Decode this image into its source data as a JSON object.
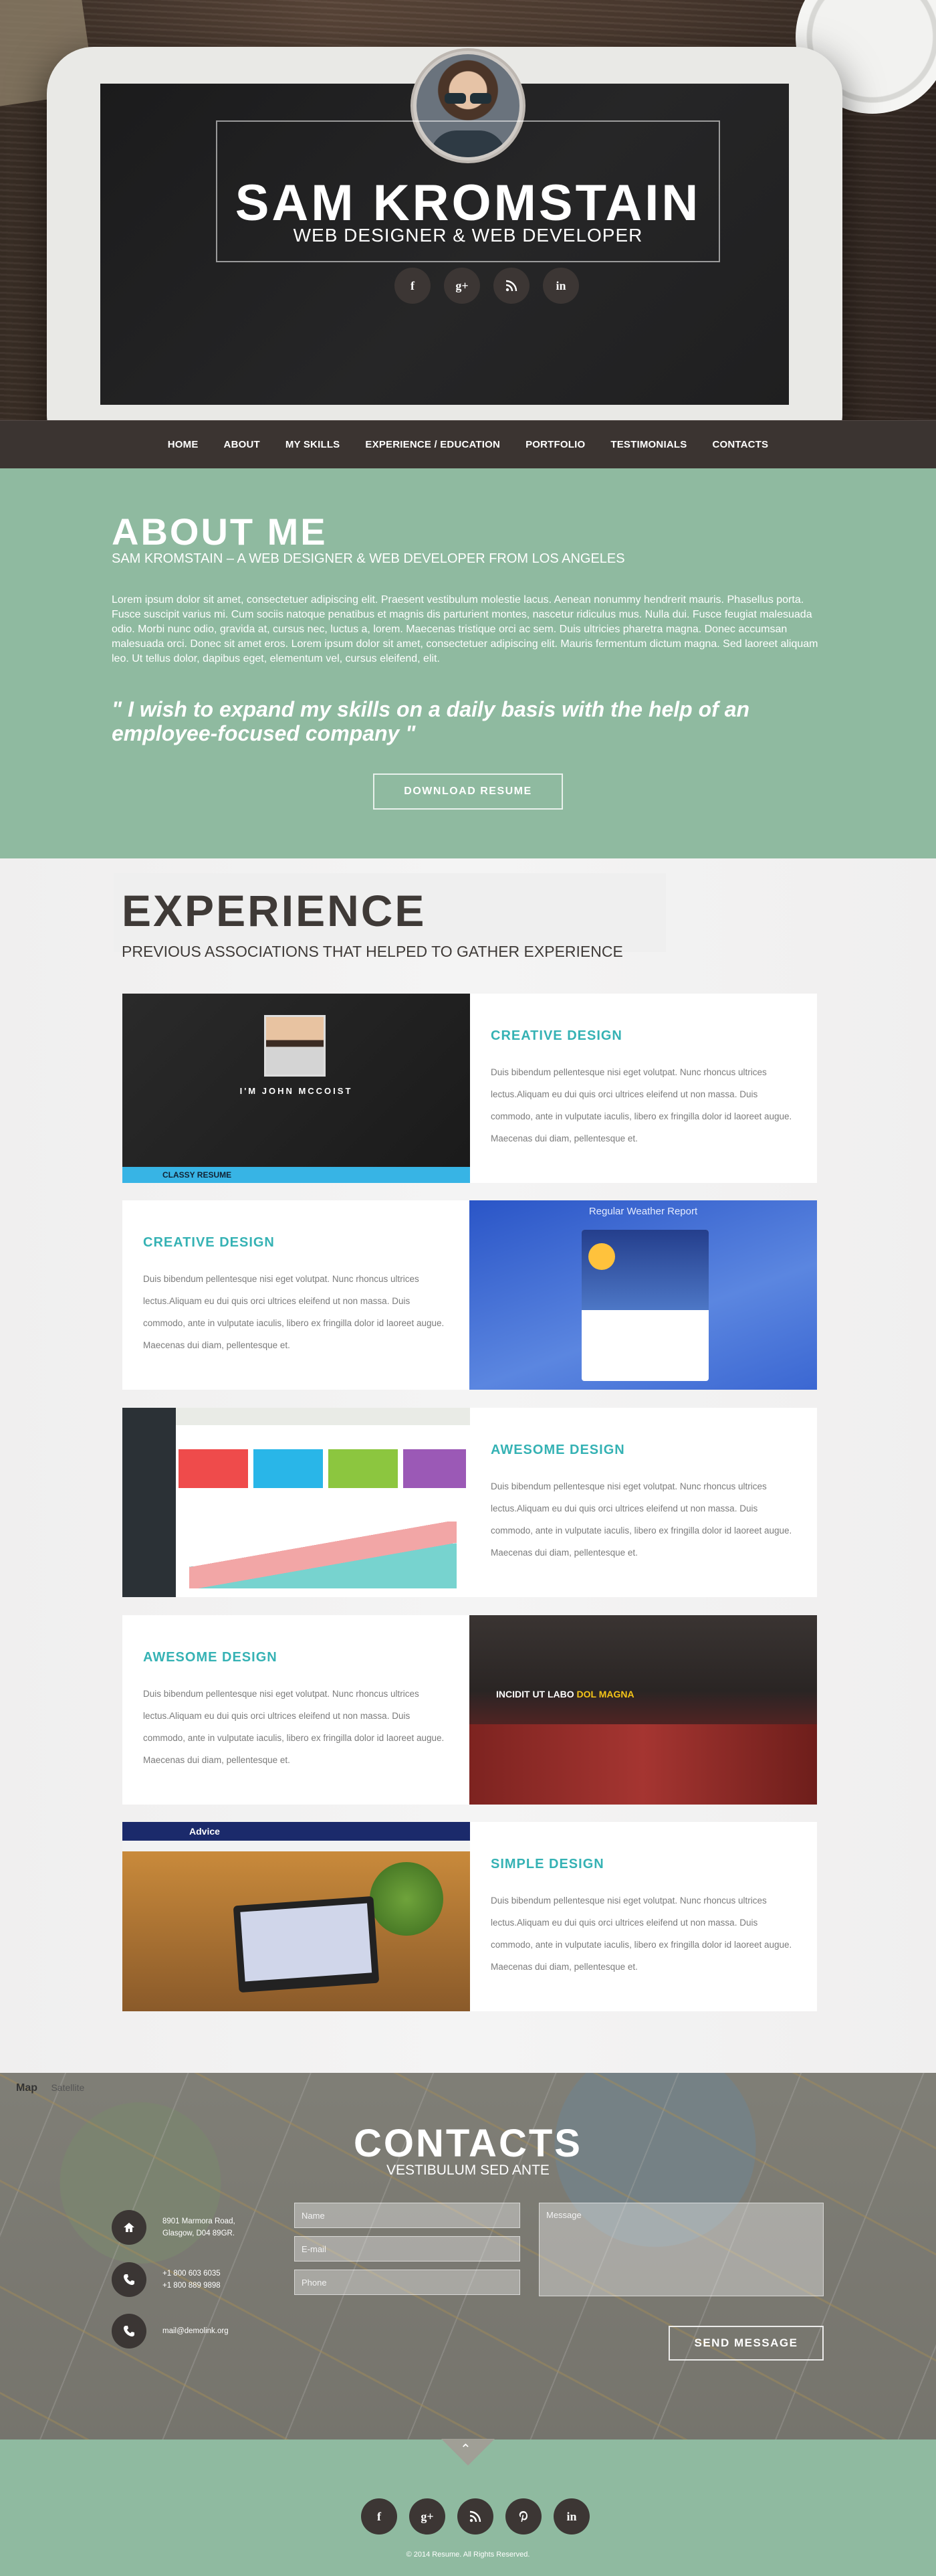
{
  "hero": {
    "name": "SAM KROMSTAIN",
    "title": "WEB DESIGNER & WEB DEVELOPER",
    "social": [
      {
        "icon": "facebook-icon",
        "glyph": "f"
      },
      {
        "icon": "google-plus-icon",
        "glyph": "g+"
      },
      {
        "icon": "rss-icon",
        "glyph": ""
      },
      {
        "icon": "linkedin-icon",
        "glyph": "in"
      }
    ]
  },
  "nav": [
    "HOME",
    "ABOUT",
    "MY SKILLS",
    "EXPERIENCE / EDUCATION",
    "PORTFOLIO",
    "TESTIMONIALS",
    "CONTACTS"
  ],
  "about": {
    "heading": "ABOUT ME",
    "subheading": "SAM KROMSTAIN – A WEB DESIGNER & WEB DEVELOPER FROM LOS ANGELES",
    "body": "Lorem ipsum dolor sit amet, consectetuer adipiscing elit. Praesent vestibulum molestie lacus. Aenean nonummy hendrerit mauris. Phasellus porta. Fusce suscipit varius mi. Cum sociis natoque penatibus et magnis dis parturient montes, nascetur ridiculus mus. Nulla dui. Fusce feugiat malesuada odio. Morbi nunc odio, gravida at, cursus nec, luctus a, lorem. Maecenas tristique orci ac sem. Duis ultricies pharetra magna. Donec accumsan malesuada orci. Donec sit amet eros. Lorem ipsum dolor sit amet, consectetuer adipiscing elit. Mauris fermentum dictum magna. Sed laoreet aliquam leo. Ut tellus dolor, dapibus eget, elementum vel, cursus eleifend, elit.",
    "quote": "\" I wish to expand my skills on a daily basis with the help of an employee-focused company \"",
    "button": "DOWNLOAD RESUME"
  },
  "experience": {
    "heading": "EXPERIENCE",
    "subheading": "PREVIOUS ASSOCIATIONS THAT HELPED TO GATHER EXPERIENCE",
    "items": [
      {
        "title": "CREATIVE DESIGN",
        "text": "Duis bibendum pellentesque nisi eget volutpat. Nunc rhoncus ultrices lectus.Aliquam eu dui quis orci ultrices eleifend ut non massa. Duis commodo, ante in vulputate iaculis, libero ex fringilla dolor id laoreet augue. Maecenas dui diam, pellentesque et."
      },
      {
        "title": "CREATIVE DESIGN",
        "text": "Duis bibendum pellentesque nisi eget volutpat. Nunc rhoncus ultrices lectus.Aliquam eu dui quis orci ultrices eleifend ut non massa. Duis commodo, ante in vulputate iaculis, libero ex fringilla dolor id laoreet augue. Maecenas dui diam, pellentesque et."
      },
      {
        "title": "AWESOME DESIGN",
        "text": "Duis bibendum pellentesque nisi eget volutpat. Nunc rhoncus ultrices lectus.Aliquam eu dui quis orci ultrices eleifend ut non massa. Duis commodo, ante in vulputate iaculis, libero ex fringilla dolor id laoreet augue. Maecenas dui diam, pellentesque et."
      },
      {
        "title": "AWESOME DESIGN",
        "text": "Duis bibendum pellentesque nisi eget volutpat. Nunc rhoncus ultrices lectus.Aliquam eu dui quis orci ultrices eleifend ut non massa. Duis commodo, ante in vulputate iaculis, libero ex fringilla dolor id laoreet augue. Maecenas dui diam, pellentesque et."
      },
      {
        "title": "SIMPLE DESIGN",
        "text": "Duis bibendum pellentesque nisi eget volutpat. Nunc rhoncus ultrices lectus.Aliquam eu dui quis orci ultrices eleifend ut non massa. Duis commodo, ante in vulputate iaculis, libero ex fringilla dolor id laoreet augue. Maecenas dui diam, pellentesque et."
      }
    ],
    "thumbs": {
      "t1_name": "I'M JOHN MCCOIST",
      "t1_bar": "CLASSY RESUME",
      "t2_caption": "Regular Weather Report",
      "t4_heading": "INCIDIT UT LABO",
      "t4_highlight": "DOL MAGNA",
      "t5_bar": "Advice"
    }
  },
  "contacts": {
    "map_label": "Map",
    "map_alt": "Satellite",
    "heading": "CONTACTS",
    "subheading": "VESTIBULUM SED ANTE",
    "address_line1": "8901 Marmora Road,",
    "address_line2": "Glasgow, D04 89GR.",
    "phone1": "+1 800 603 6035",
    "phone2": "+1 800 889 9898",
    "email": "mail@demolink.org",
    "name_placeholder": "Name",
    "email_placeholder": "E-mail",
    "phone_placeholder": "Phone",
    "message_placeholder": "Message",
    "send": "SEND MESSAGE"
  },
  "footer": {
    "social": [
      "facebook-icon",
      "google-plus-icon",
      "rss-icon",
      "pinterest-icon",
      "linkedin-icon"
    ],
    "copyright": "© 2014 Resume. All Rights Reserved."
  },
  "colors": {
    "accent": "#8fbaa0",
    "heading_teal": "#35b2b4",
    "nav_bg": "#3b3431",
    "icon_circle": "#3c3634"
  }
}
